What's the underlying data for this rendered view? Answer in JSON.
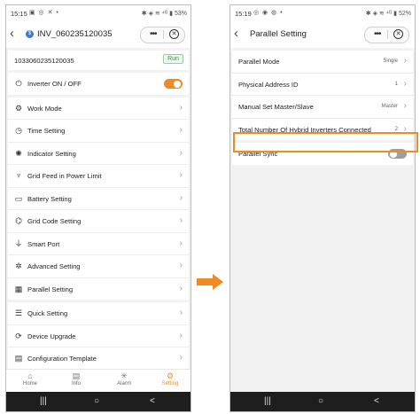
{
  "left_screen": {
    "status": {
      "time": "15:15",
      "icons": "▣ ◎ ✕ •",
      "battery": "53%"
    },
    "header": {
      "title": "INV_060235120035",
      "badge": "$",
      "more_label": "•••",
      "close_label": "✕"
    },
    "device": {
      "serial": "1033060235120035",
      "status_badge": "Run"
    },
    "inverter_toggle": {
      "label": "Inverter ON / OFF",
      "state": "on"
    },
    "menu": [
      {
        "label": "Work Mode",
        "icon": "gear-icon",
        "glyph": "⚙"
      },
      {
        "label": "Time Setting",
        "icon": "clock-icon",
        "glyph": "◷"
      },
      {
        "label": "Indicator Setting",
        "icon": "sun-icon",
        "glyph": "✺"
      },
      {
        "label": "Grid Feed in Power Limit",
        "icon": "tower-icon",
        "glyph": "♆"
      },
      {
        "label": "Battery Setting",
        "icon": "battery-icon",
        "glyph": "▭"
      },
      {
        "label": "Grid Code Setting",
        "icon": "grid-code-icon",
        "glyph": "⌬"
      },
      {
        "label": "Smart Port",
        "icon": "plug-icon",
        "glyph": "⏚"
      },
      {
        "label": "Advanced Setting",
        "icon": "advanced-gear-icon",
        "glyph": "✲"
      },
      {
        "label": "Parallel Setting",
        "icon": "parallel-icon",
        "glyph": "▦"
      }
    ],
    "menu2": [
      {
        "label": "Quick Setting",
        "icon": "sliders-icon",
        "glyph": "☰"
      },
      {
        "label": "Device Upgrade",
        "icon": "upgrade-icon",
        "glyph": "⟳"
      },
      {
        "label": "Configuration Template",
        "icon": "template-icon",
        "glyph": "▤"
      }
    ],
    "tabs": [
      {
        "label": "Home",
        "glyph": "⌂"
      },
      {
        "label": "Info",
        "glyph": "▤"
      },
      {
        "label": "Alarm",
        "glyph": "✳"
      },
      {
        "label": "Setting",
        "glyph": "⚙"
      }
    ]
  },
  "right_screen": {
    "status": {
      "time": "15:19",
      "icons": "◎ ◉ ◍ •",
      "battery": "52%"
    },
    "header": {
      "title": "Parallel Setting",
      "more_label": "•••",
      "close_label": "✕"
    },
    "rows": [
      {
        "label": "Parallel Mode",
        "value": "Single"
      },
      {
        "label": "Physical Address ID",
        "value": "1"
      },
      {
        "label": "Manual Set Master/Slave",
        "value": "Master"
      },
      {
        "label": "Total Number Of Hybrid Inverters Connected",
        "value": "2"
      }
    ],
    "sync": {
      "label": "Parallel Sync",
      "state": "off"
    }
  },
  "status_right_icons": "✱ ◈ ≋ ⁴ᴳ ▮",
  "nav": {
    "recent": "|||",
    "home": "○",
    "back": "<"
  },
  "colors": {
    "accent": "#f08a24",
    "run_green": "#2e9e4a",
    "badge_blue": "#3a7bd5"
  }
}
